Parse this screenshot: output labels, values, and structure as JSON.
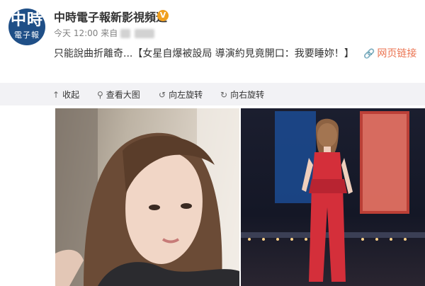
{
  "account": {
    "avatar_line1": "中時",
    "avatar_line2": "電子報",
    "name": "中時電子報新影視頻道",
    "verified_mark": "V"
  },
  "meta": {
    "time": "今天 12:00",
    "source_label": "来自"
  },
  "post": {
    "text": "只能說曲折離奇...【女星自爆被設局 導演約見竟開口：我要睡妳！】",
    "link_label": "网页链接",
    "link_icon": "link-icon"
  },
  "toolbar": {
    "collapse": "收起",
    "view_large": "查看大图",
    "rotate_left": "向左旋转",
    "rotate_right": "向右旋转"
  },
  "colors": {
    "link": "#eb7350",
    "toolbar_bg": "#f2f2f5",
    "avatar_bg": "#1f4f87",
    "verified": "#f0a020"
  }
}
